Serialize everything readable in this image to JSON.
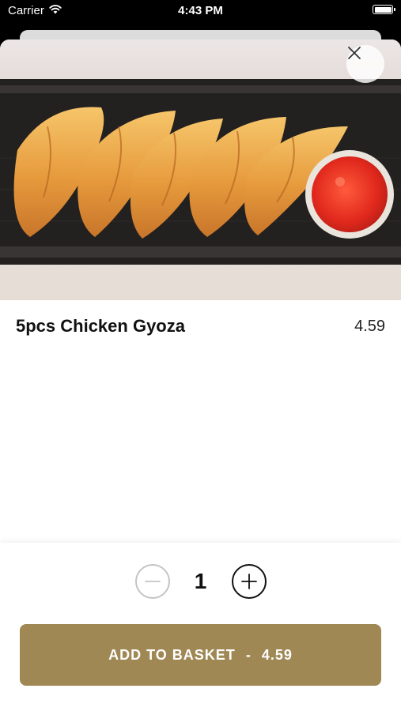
{
  "status_bar": {
    "carrier": "Carrier",
    "time": "4:43 PM",
    "battery_level": 1.0
  },
  "icons": {
    "wifi": "wifi-icon",
    "battery": "battery-icon",
    "close": "close-icon",
    "minus": "minus-icon",
    "plus": "plus-icon"
  },
  "product": {
    "name": "5pcs Chicken Gyoza",
    "price": "4.59",
    "image_alt": "gyoza-photo"
  },
  "stepper": {
    "quantity": "1"
  },
  "add_button": {
    "label": "ADD TO BASKET",
    "separator": "-",
    "price": "4.59"
  },
  "colors": {
    "accent": "#a08855",
    "minus_border": "#c4c4c4",
    "plus_border": "#111111"
  }
}
